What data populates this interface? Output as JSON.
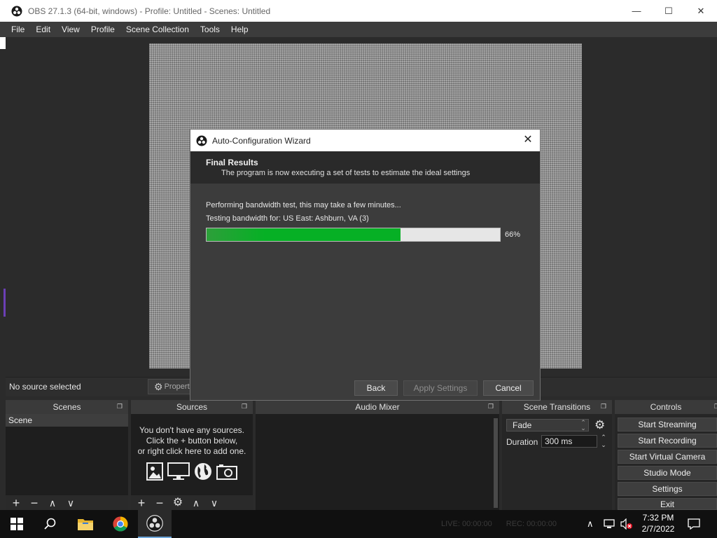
{
  "window": {
    "title": "OBS 27.1.3 (64-bit, windows) - Profile: Untitled - Scenes: Untitled",
    "minimize_icon": "minimize-icon",
    "maximize_icon": "maximize-icon",
    "close_icon": "close-icon"
  },
  "menu": [
    "File",
    "Edit",
    "View",
    "Profile",
    "Scene Collection",
    "Tools",
    "Help"
  ],
  "source_toolbar": {
    "status": "No source selected",
    "properties_label": "Propert"
  },
  "docks": {
    "scenes": {
      "title": "Scenes",
      "items": [
        "Scene"
      ]
    },
    "sources": {
      "title": "Sources",
      "empty_line1": "You don't have any sources.",
      "empty_line2": "Click the + button below,",
      "empty_line3": "or right click here to add one."
    },
    "mixer": {
      "title": "Audio Mixer"
    },
    "transitions": {
      "title": "Scene Transitions",
      "selected": "Fade",
      "duration_label": "Duration",
      "duration_value": "300 ms"
    },
    "controls": {
      "title": "Controls",
      "buttons": [
        "Start Streaming",
        "Start Recording",
        "Start Virtual Camera",
        "Studio Mode",
        "Settings",
        "Exit"
      ]
    }
  },
  "dialog": {
    "title": "Auto-Configuration Wizard",
    "heading": "Final Results",
    "subheading": "The program is now executing a set of tests to estimate the ideal settings",
    "line1": "Performing bandwidth test, this may take a few minutes...",
    "line2": "Testing bandwidth for: US East: Ashburn, VA (3)",
    "progress_percent": 66,
    "progress_label": "66%",
    "back": "Back",
    "apply": "Apply Settings",
    "cancel": "Cancel"
  },
  "status": {
    "live": "LIVE: 00:00:00",
    "rec": "REC: 00:00:00"
  },
  "taskbar": {
    "time": "7:32 PM",
    "date": "2/7/2022"
  },
  "colors": {
    "progress_fill": "#06b025",
    "dock_bg": "#262626",
    "menu_bg": "#3c3c3c"
  }
}
